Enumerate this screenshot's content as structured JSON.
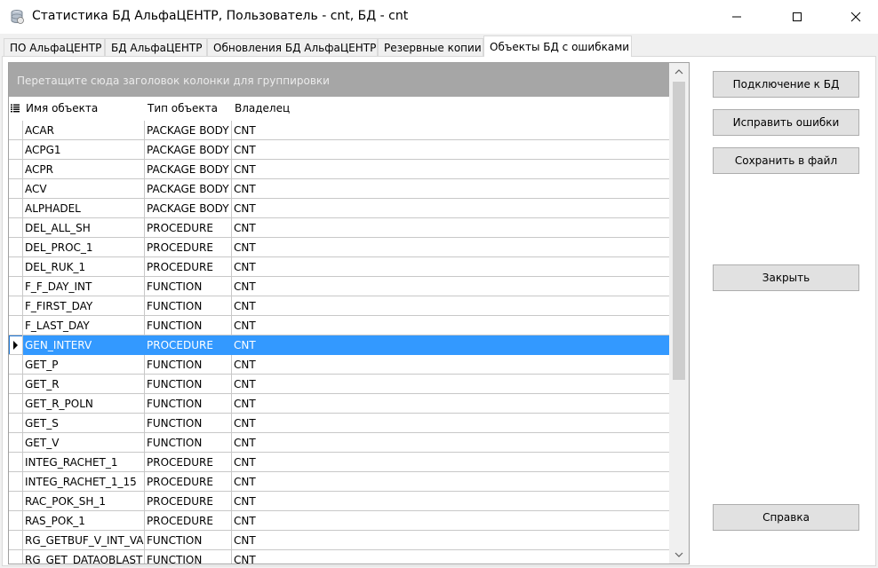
{
  "window": {
    "title": "Статистика БД АльфаЦЕНТР, Пользователь - cnt, БД - cnt",
    "icon": "database-disk-icon"
  },
  "tabs": [
    {
      "label": "ПО АльфаЦЕНТР"
    },
    {
      "label": "БД АльфаЦЕНТР"
    },
    {
      "label": "Обновления БД АльфаЦЕНТР"
    },
    {
      "label": "Резервные копии"
    },
    {
      "label": "Объекты БД с ошибками",
      "active": true
    }
  ],
  "grid": {
    "group_hint": "Перетащите сюда заголовок колонки для группировки",
    "columns": [
      "Имя объекта",
      "Тип объекта",
      "Владелец"
    ],
    "selected_row": "GEN_INTERV",
    "rows": [
      [
        "ACAR",
        "PACKAGE BODY",
        "CNT"
      ],
      [
        "ACPG1",
        "PACKAGE BODY",
        "CNT"
      ],
      [
        "ACPR",
        "PACKAGE BODY",
        "CNT"
      ],
      [
        "ACV",
        "PACKAGE BODY",
        "CNT"
      ],
      [
        "ALPHADEL",
        "PACKAGE BODY",
        "CNT"
      ],
      [
        "DEL_ALL_SH",
        "PROCEDURE",
        "CNT"
      ],
      [
        "DEL_PROC_1",
        "PROCEDURE",
        "CNT"
      ],
      [
        "DEL_RUK_1",
        "PROCEDURE",
        "CNT"
      ],
      [
        "F_F_DAY_INT",
        "FUNCTION",
        "CNT"
      ],
      [
        "F_FIRST_DAY",
        "FUNCTION",
        "CNT"
      ],
      [
        "F_LAST_DAY",
        "FUNCTION",
        "CNT"
      ],
      [
        "GEN_INTERV",
        "PROCEDURE",
        "CNT"
      ],
      [
        "GET_P",
        "FUNCTION",
        "CNT"
      ],
      [
        "GET_R",
        "FUNCTION",
        "CNT"
      ],
      [
        "GET_R_POLN",
        "FUNCTION",
        "CNT"
      ],
      [
        "GET_S",
        "FUNCTION",
        "CNT"
      ],
      [
        "GET_V",
        "FUNCTION",
        "CNT"
      ],
      [
        "INTEG_RACHET_1",
        "PROCEDURE",
        "CNT"
      ],
      [
        "INTEG_RACHET_1_15",
        "PROCEDURE",
        "CNT"
      ],
      [
        "RAC_POK_SH_1",
        "PROCEDURE",
        "CNT"
      ],
      [
        "RAS_POK_1",
        "PROCEDURE",
        "CNT"
      ],
      [
        "RG_GETBUF_V_INT_VAL",
        "FUNCTION",
        "CNT"
      ],
      [
        "RG_GET_DATAOBLAST",
        "FUNCTION",
        "CNT"
      ]
    ]
  },
  "buttons": {
    "connect": "Подключение к БД",
    "fix": "Исправить ошибки",
    "save": "Сохранить в файл",
    "close": "Закрыть",
    "help": "Справка"
  },
  "colors": {
    "selection": "#3399ff",
    "group_panel": "#a6a6a6"
  }
}
